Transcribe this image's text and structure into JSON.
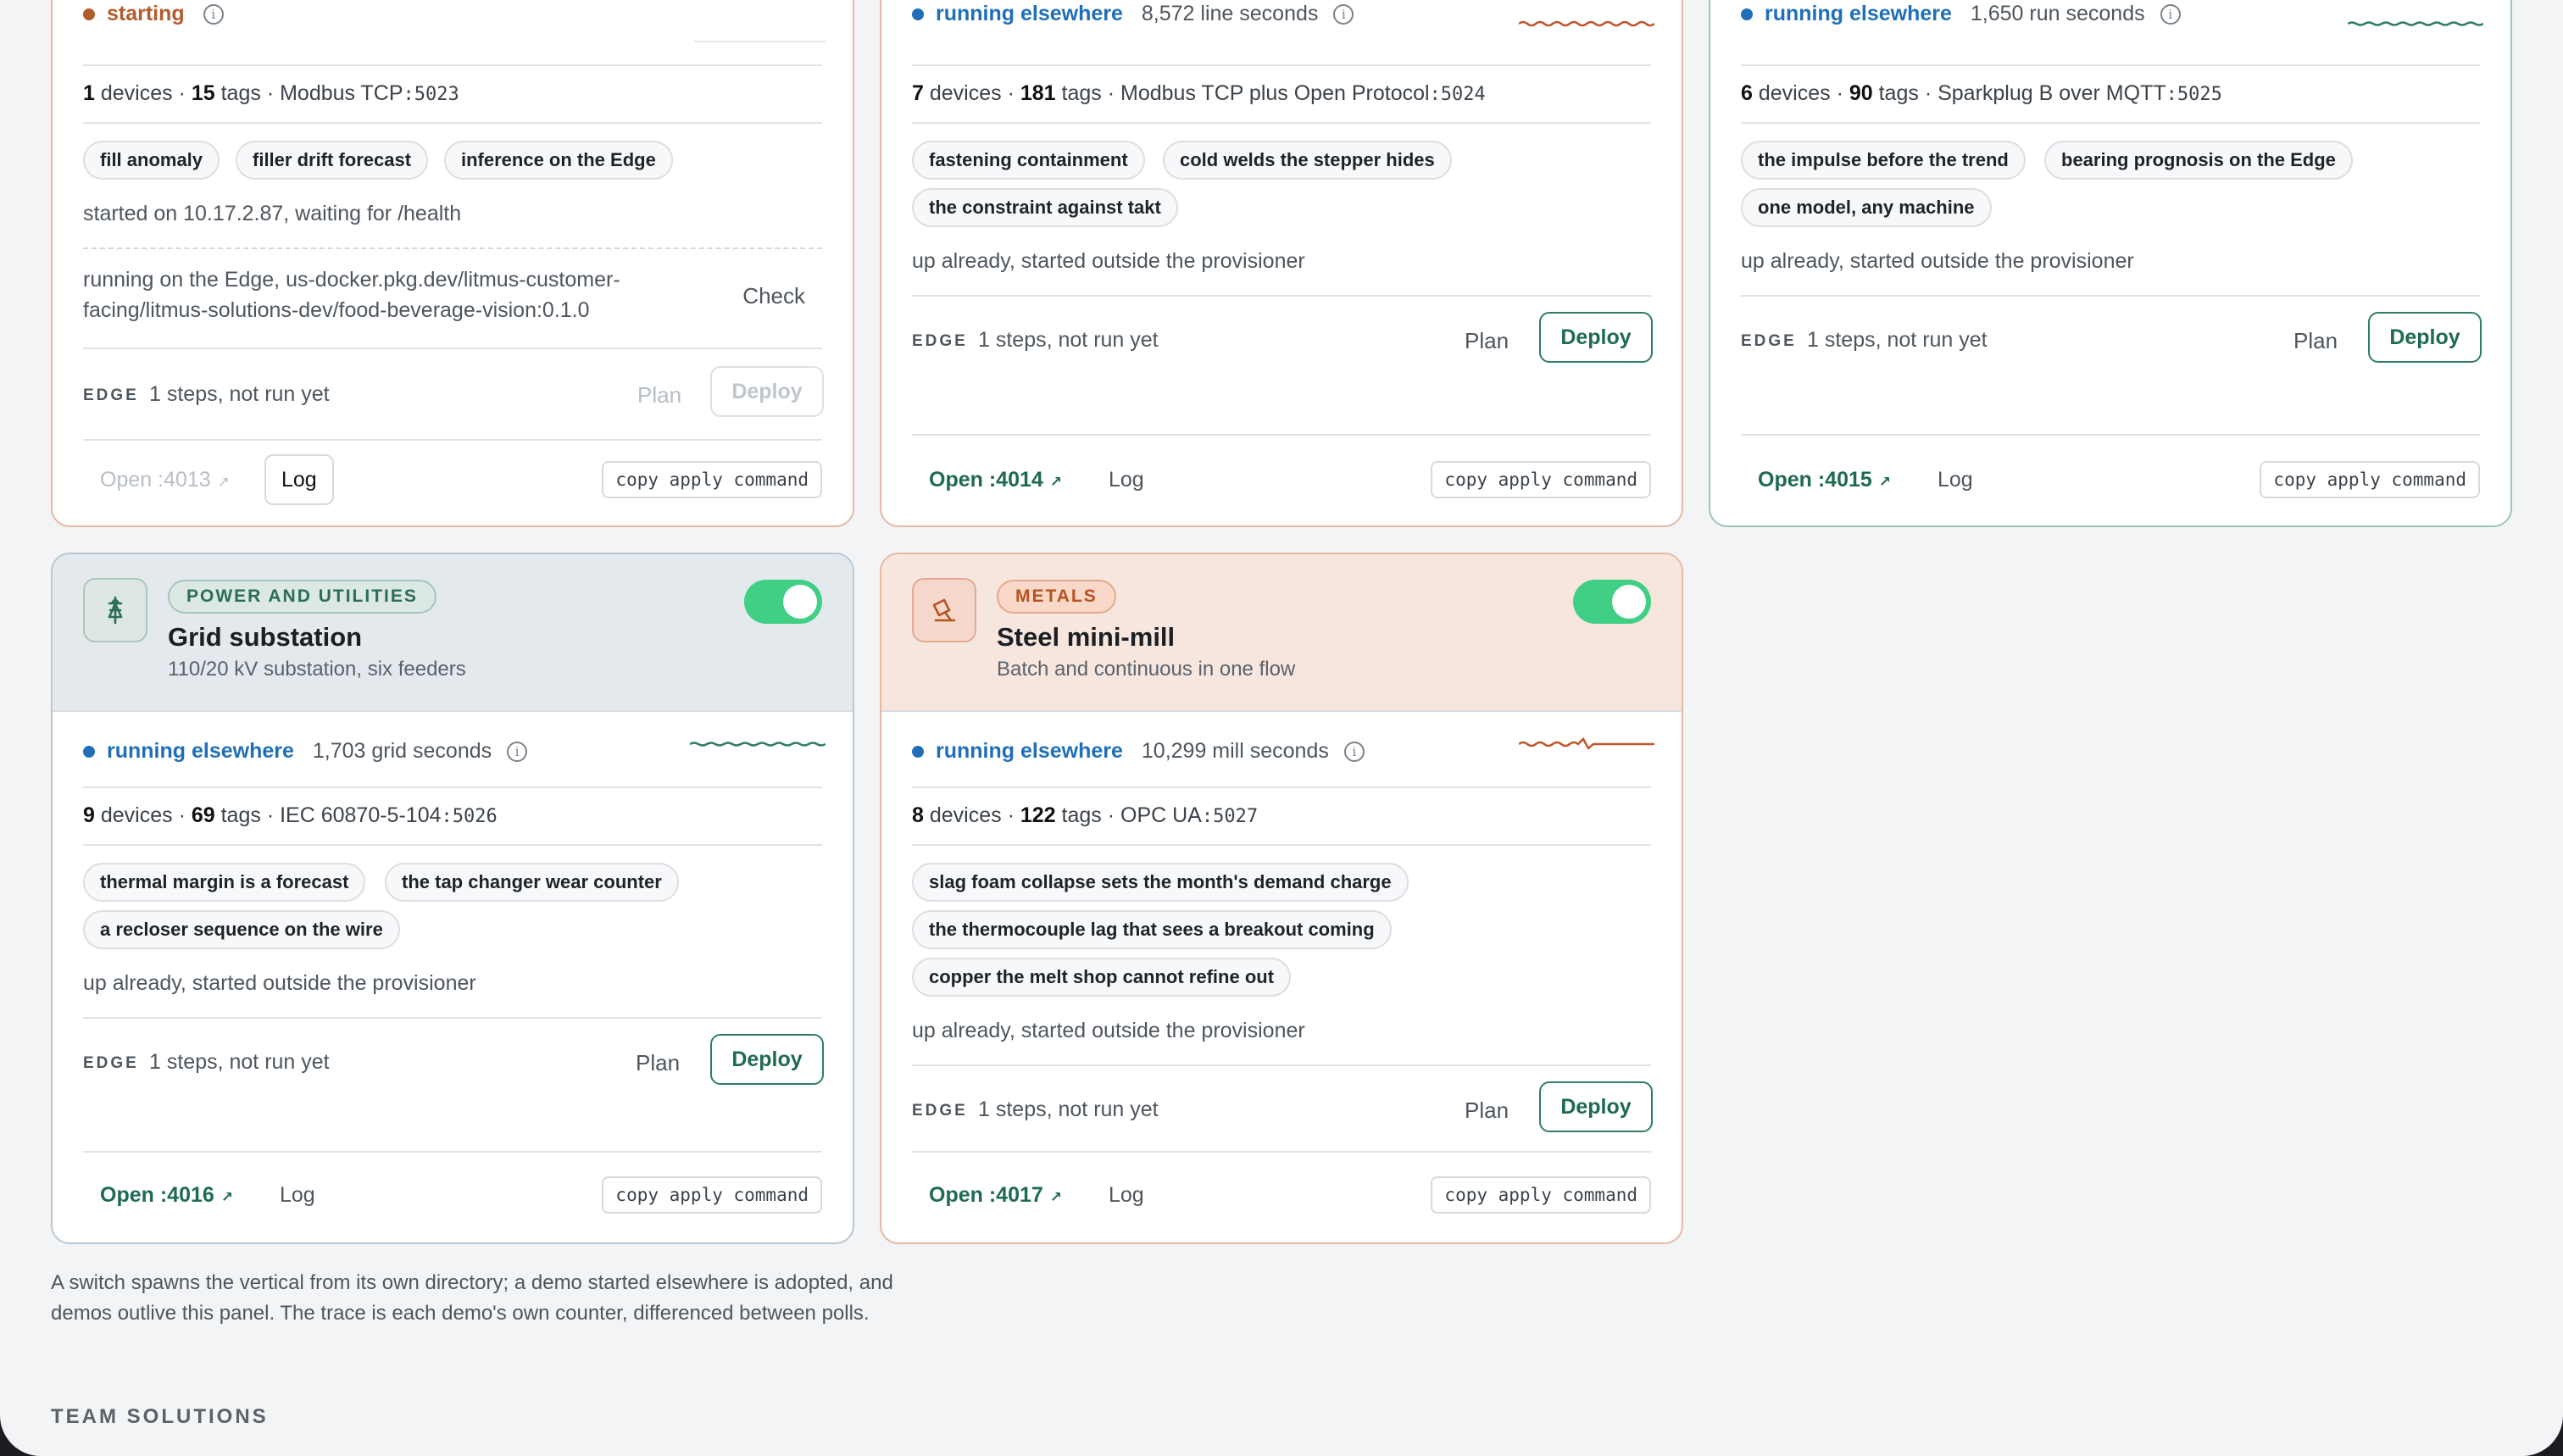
{
  "cards_top": [
    {
      "status": "starting",
      "status_color": "#b35c2b",
      "devices": "1",
      "devices_label": "devices",
      "tags": "15",
      "tags_label": "tags",
      "protocol": "Modbus TCP",
      "port": ":5023",
      "chips": [
        "fill anomaly",
        "filler drift forecast",
        "inference on the Edge"
      ],
      "note": "started on 10.17.2.87, waiting for /health",
      "edge_note_line1": "running on the Edge, us-docker.pkg.dev/litmus-customer-",
      "edge_note_line2": "facing/litmus-solutions-dev/food-beverage-vision:0.1.0",
      "check": "Check",
      "edge_label": "EDGE",
      "steps": "1 steps, not run yet",
      "plan": "Plan",
      "deploy": "Deploy",
      "open": "Open :4013",
      "log": "Log",
      "copy": "copy apply command"
    },
    {
      "status": "running elsewhere",
      "status_color": "#1f6fb8",
      "counter": "8,572 line seconds",
      "devices": "7",
      "devices_label": "devices",
      "tags": "181",
      "tags_label": "tags",
      "protocol": "Modbus TCP plus Open Protocol",
      "port": ":5024",
      "chips": [
        "fastening containment",
        "cold welds the stepper hides",
        "the constraint against takt"
      ],
      "note": "up already, started outside the provisioner",
      "edge_label": "EDGE",
      "steps": "1 steps, not run yet",
      "plan": "Plan",
      "deploy": "Deploy",
      "open": "Open :4014",
      "log": "Log",
      "copy": "copy apply command",
      "spark_color": "#c0562a"
    },
    {
      "status": "running elsewhere",
      "status_color": "#1f6fb8",
      "counter": "1,650 run seconds",
      "devices": "6",
      "devices_label": "devices",
      "tags": "90",
      "tags_label": "tags",
      "protocol": "Sparkplug B over MQTT",
      "port": ":5025",
      "chips": [
        "the impulse before the trend",
        "bearing prognosis on the Edge",
        "one model, any machine"
      ],
      "note": "up already, started outside the provisioner",
      "edge_label": "EDGE",
      "steps": "1 steps, not run yet",
      "plan": "Plan",
      "deploy": "Deploy",
      "open": "Open :4015",
      "log": "Log",
      "copy": "copy apply command",
      "spark_color": "#2f7e5f"
    }
  ],
  "cards_bottom": [
    {
      "sector": "POWER AND UTILITIES",
      "title": "Grid substation",
      "subtitle": "110/20 kV substation, six feeders",
      "icon": "tower-icon",
      "status": "running elsewhere",
      "status_color": "#1f6fb8",
      "counter": "1,703 grid seconds",
      "devices": "9",
      "devices_label": "devices",
      "tags": "69",
      "tags_label": "tags",
      "protocol": "IEC 60870-5-104",
      "port": ":5026",
      "chips": [
        "thermal margin is a forecast",
        "the tap changer wear counter",
        "a recloser sequence on the wire"
      ],
      "note": "up already, started outside the provisioner",
      "edge_label": "EDGE",
      "steps": "1 steps, not run yet",
      "plan": "Plan",
      "deploy": "Deploy",
      "open": "Open :4016",
      "log": "Log",
      "copy": "copy apply command",
      "spark_color": "#2f7e5f"
    },
    {
      "sector": "METALS",
      "title": "Steel mini-mill",
      "subtitle": "Batch and continuous in one flow",
      "icon": "ladle-icon",
      "status": "running elsewhere",
      "status_color": "#1f6fb8",
      "counter": "10,299 mill seconds",
      "devices": "8",
      "devices_label": "devices",
      "tags": "122",
      "tags_label": "tags",
      "protocol": "OPC UA",
      "port": ":5027",
      "chips": [
        "slag foam collapse sets the month's demand charge",
        "the thermocouple lag that sees a breakout coming",
        "copper the melt shop cannot refine out"
      ],
      "note": "up already, started outside the provisioner",
      "edge_label": "EDGE",
      "steps": "1 steps, not run yet",
      "plan": "Plan",
      "deploy": "Deploy",
      "open": "Open :4017",
      "log": "Log",
      "copy": "copy apply command",
      "spark_color": "#c0562a"
    }
  ],
  "footnote": "A switch spawns the vertical from its own directory; a demo started elsewhere is adopted, and demos outlive this panel. The trace is each demo's own counter, differenced between polls.",
  "section_title": "TEAM SOLUTIONS"
}
